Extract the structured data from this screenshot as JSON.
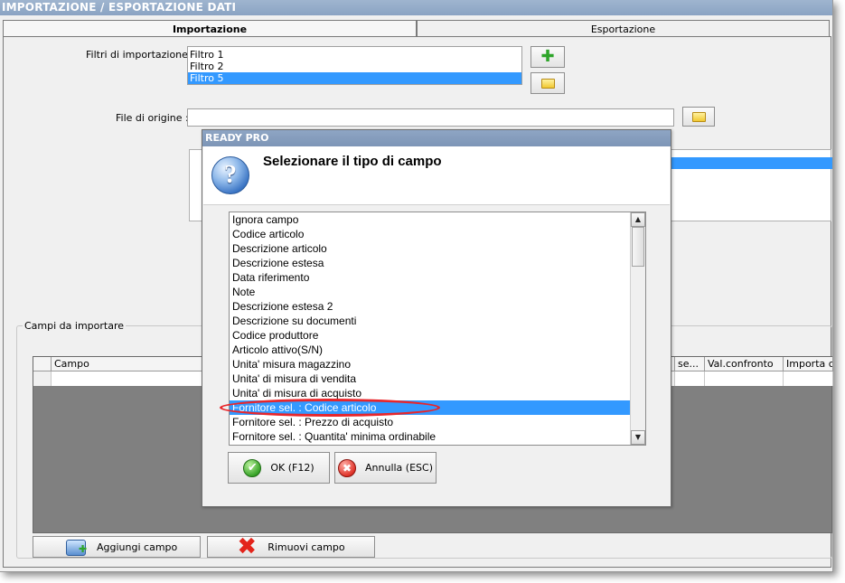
{
  "window": {
    "title": "IMPORTAZIONE / ESPORTAZIONE DATI"
  },
  "tabs": [
    {
      "label": "Importazione",
      "active": true
    },
    {
      "label": "Esportazione",
      "active": false
    }
  ],
  "filters": {
    "label": "Filtri di importazione :",
    "items": [
      "Filtro 1",
      "Filtro 2",
      "Filtro 5"
    ],
    "selected": "Filtro 5",
    "add_icon": "plus-icon",
    "open_icon": "folder-icon"
  },
  "source_file": {
    "label": "File di origine :",
    "value": "",
    "browse_icon": "folder-icon"
  },
  "fields_group": {
    "title": "Campi da importare",
    "columns": [
      "",
      "Campo",
      "se...",
      "Val.confronto",
      "Importa ca"
    ],
    "add_button": "Aggiungi campo",
    "remove_button": "Rimuovi campo"
  },
  "dialog": {
    "title": "READY PRO",
    "heading": "Selezionare il tipo di campo",
    "icon": "question-icon",
    "items": [
      "Ignora campo",
      "Codice articolo",
      "Descrizione articolo",
      "Descrizione estesa",
      "Data riferimento",
      "Note",
      "Descrizione estesa 2",
      "Descrizione su documenti",
      "Codice produttore",
      "Articolo attivo(S/N)",
      "Unita' misura magazzino",
      "Unita' di misura di vendita",
      "Unita' di misura di acquisto",
      "Fornitore sel. : Codice articolo",
      "Fornitore sel. : Prezzo di acquisto",
      "Fornitore sel. : Quantita' minima ordinabile"
    ],
    "selected_index": 13,
    "ok_label": "OK (F12)",
    "cancel_label": "Annulla (ESC)"
  },
  "colors": {
    "selection": "#3399ff",
    "title_bar": "#8aa3c3",
    "highlight_ellipse": "#e8262b",
    "grid_background": "#808080"
  }
}
